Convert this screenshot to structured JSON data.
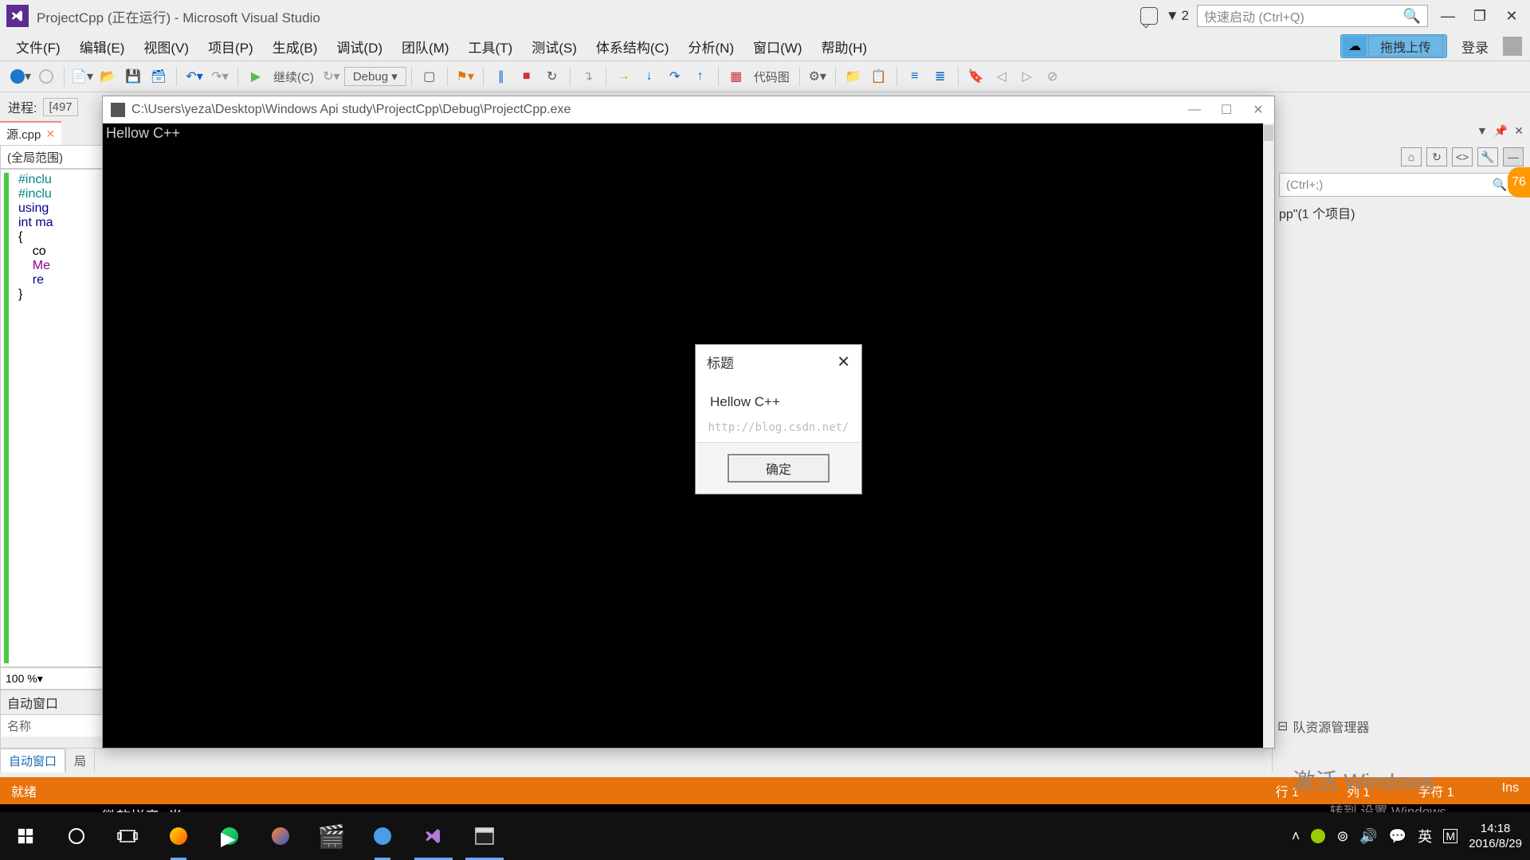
{
  "titlebar": {
    "title": "ProjectCpp (正在运行) - Microsoft Visual Studio",
    "flag_count": "2",
    "quicklaunch_placeholder": "快速启动 (Ctrl+Q)"
  },
  "menubar": {
    "items": [
      "文件(F)",
      "编辑(E)",
      "视图(V)",
      "项目(P)",
      "生成(B)",
      "调试(D)",
      "团队(M)",
      "工具(T)",
      "测试(S)",
      "体系结构(C)",
      "分析(N)",
      "窗口(W)",
      "帮助(H)"
    ],
    "upload_label": "拖拽上传",
    "login_label": "登录"
  },
  "toolbar": {
    "continue_label": "继续(C)",
    "config_label": "Debug",
    "codemap_label": "代码图"
  },
  "toolbar2": {
    "process_label": "进程:",
    "process_value": "[497"
  },
  "editor": {
    "tab_name": "源.cpp",
    "scope": "(全局范围)",
    "lines": [
      "#inclu",
      "#inclu",
      "using ",
      "",
      "int ma",
      "{",
      "    co",
      "",
      "    Me",
      "",
      "    re",
      "}"
    ],
    "zoom": "100 %"
  },
  "auto_panel": {
    "title": "自动窗口",
    "col_name": "名称"
  },
  "bottom_tabs": {
    "t1": "自动窗口",
    "t2": "局"
  },
  "right_panel": {
    "search_placeholder": "(Ctrl+;)",
    "tree_text": "pp\"(1 个项目)",
    "bottom_label": "队资源管理器",
    "badge": "76",
    "wm1": "激活 Windows",
    "wm2": "转到    设置 Windows。"
  },
  "console": {
    "title": "C:\\Users\\yeza\\Desktop\\Windows Api study\\ProjectCpp\\Debug\\ProjectCpp.exe",
    "output": "Hellow C++",
    "ime": "微软拼音  半  :"
  },
  "msgbox": {
    "title": "标题",
    "body": "Hellow C++",
    "watermark": "http://blog.csdn.net/",
    "ok": "确定"
  },
  "statusbar": {
    "ready": "就绪",
    "line": "行 1",
    "col": "列 1",
    "char": "字符 1",
    "ins": "Ins"
  },
  "taskbar": {
    "time": "14:18",
    "date": "2016/8/29",
    "ime_lang": "英",
    "ime_m": "M"
  }
}
